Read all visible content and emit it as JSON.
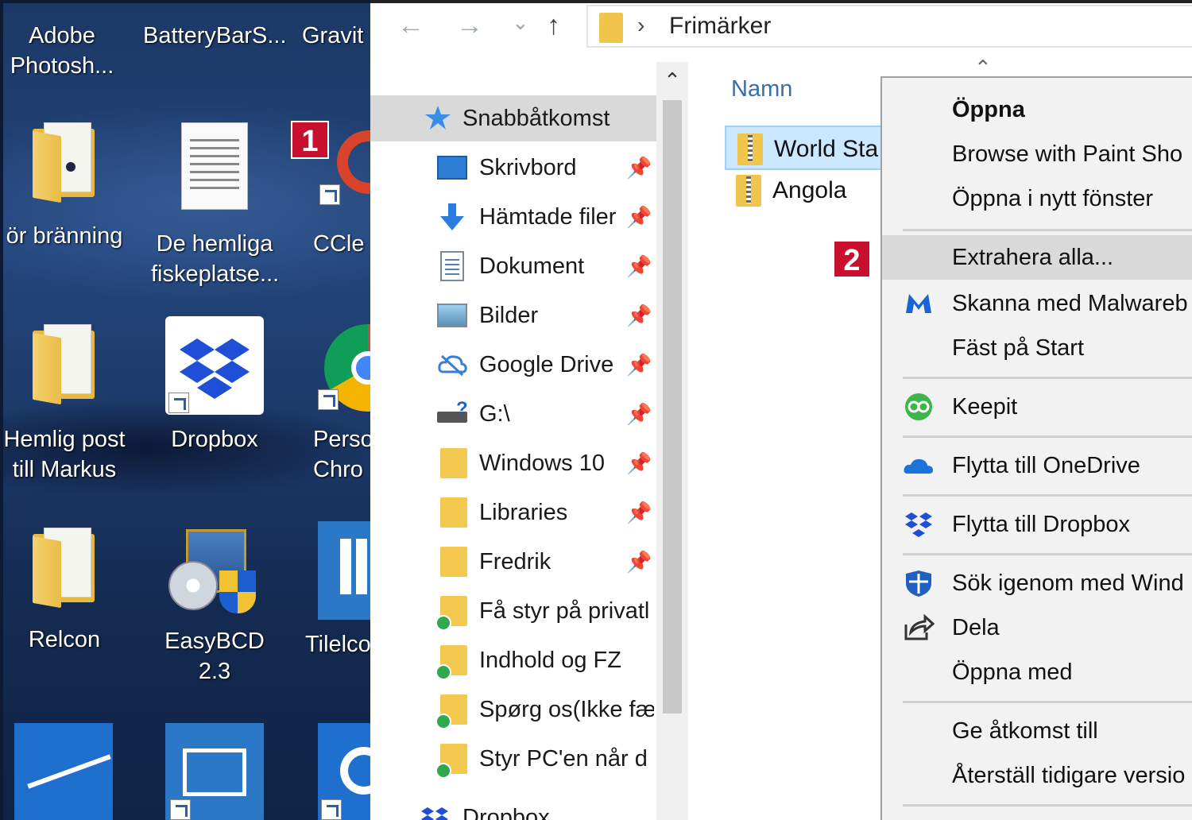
{
  "desktop": {
    "icons": [
      {
        "label1": "Adobe",
        "label2": "Photosh..."
      },
      {
        "label1": "BatteryBarS...",
        "label2": ""
      },
      {
        "label1": "Gravit",
        "label2": ""
      },
      {
        "label1": "ör bränning",
        "label2": ""
      },
      {
        "label1": "De hemliga",
        "label2": "fiskeplatse..."
      },
      {
        "label1": "CCle",
        "label2": ""
      },
      {
        "label1": "Hemlig post",
        "label2": "till Markus"
      },
      {
        "label1": "Dropbox",
        "label2": ""
      },
      {
        "label1": "Perso",
        "label2": "Chro"
      },
      {
        "label1": "Relcon",
        "label2": ""
      },
      {
        "label1": "EasyBCD 2.3",
        "label2": ""
      },
      {
        "label1": "Tilelco",
        "label2": ""
      }
    ]
  },
  "badges": {
    "one": "1",
    "two": "2"
  },
  "explorer": {
    "address": {
      "back": "←",
      "forward": "→",
      "history": "⌄",
      "up": "↑",
      "separator": "›",
      "path": "Frimärker"
    },
    "nav": {
      "quick_access": "Snabbåtkomst",
      "items": [
        {
          "label": "Skrivbord"
        },
        {
          "label": "Hämtade filer"
        },
        {
          "label": "Dokument"
        },
        {
          "label": "Bilder"
        },
        {
          "label": "Google Drive"
        },
        {
          "label": "G:\\"
        },
        {
          "label": "Windows 10"
        },
        {
          "label": "Libraries"
        },
        {
          "label": "Fredrik"
        },
        {
          "label": "Få styr på privatl"
        },
        {
          "label": "Indhold og FZ"
        },
        {
          "label": "Spørg os(Ikke fæ"
        },
        {
          "label": "Styr PC'en når d"
        }
      ],
      "dropbox": "Dropbox"
    },
    "content": {
      "column_name": "Namn",
      "files": [
        {
          "name": "World Sta"
        },
        {
          "name": "Angola"
        }
      ]
    }
  },
  "context_menu": {
    "items": [
      "Öppna",
      "Browse with Paint Sho",
      "Öppna i nytt fönster",
      "Extrahera alla...",
      "Skanna med Malwareb",
      "Fäst på Start",
      "Keepit",
      "Flytta till OneDrive",
      "Flytta till Dropbox",
      "Sök igenom med Wind",
      "Dela",
      "Öppna med",
      "Ge åtkomst till",
      "Återställ tidigare versio"
    ]
  }
}
